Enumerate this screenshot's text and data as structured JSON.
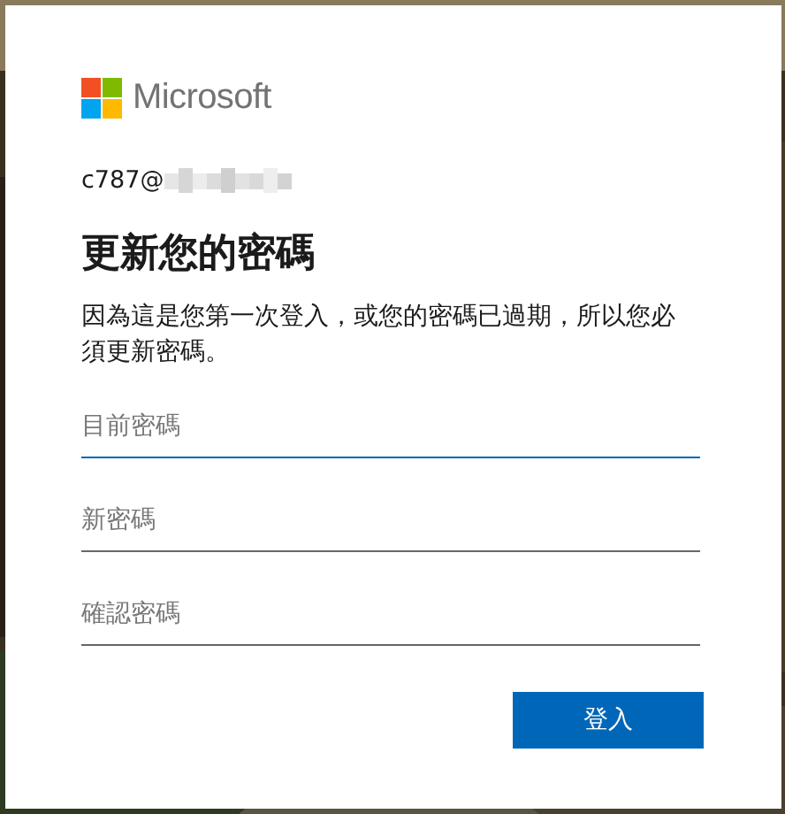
{
  "brand": {
    "name": "Microsoft"
  },
  "account": {
    "email": "c787@",
    "redacted": true
  },
  "title": "更新您的密碼",
  "description": "因為這是您第一次登入，或您的密碼已過期，所以您必須更新密碼。",
  "fields": [
    {
      "placeholder": "目前密碼",
      "focused": true
    },
    {
      "placeholder": "新密碼",
      "focused": false
    },
    {
      "placeholder": "確認密碼",
      "focused": false
    }
  ],
  "submit": {
    "label": "登入"
  }
}
